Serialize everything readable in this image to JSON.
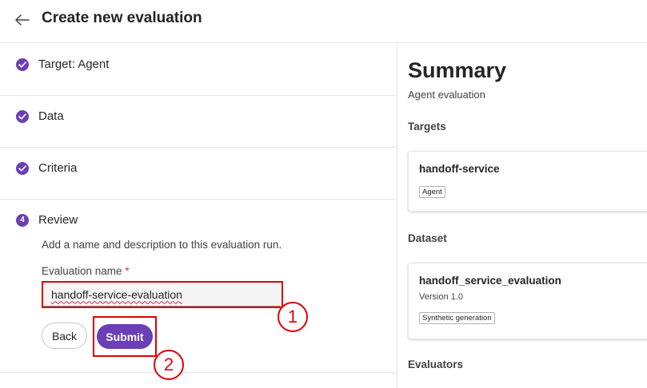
{
  "header": {
    "title": "Create new evaluation"
  },
  "steps": [
    {
      "label": "Target: Agent",
      "status": "complete"
    },
    {
      "label": "Data",
      "status": "complete"
    },
    {
      "label": "Criteria",
      "status": "complete"
    },
    {
      "label": "Review",
      "status": "current",
      "number": "4"
    }
  ],
  "review": {
    "description": "Add a name and description to this evaluation run.",
    "name_label": "Evaluation name",
    "required_mark": "*",
    "name_value": "handoff-service-evaluation",
    "back_label": "Back",
    "submit_label": "Submit"
  },
  "annotations": {
    "marker_1": "1",
    "marker_2": "2"
  },
  "summary": {
    "title": "Summary",
    "subtitle": "Agent evaluation",
    "targets_label": "Targets",
    "target": {
      "name": "handoff-service",
      "tag": "Agent"
    },
    "dataset_label": "Dataset",
    "dataset": {
      "name": "handoff_service_evaluation",
      "version": "Version 1.0",
      "tag": "Synthetic generation"
    },
    "evaluators_label": "Evaluators"
  },
  "colors": {
    "accent": "#6b3fb5",
    "annotation": "#e00000",
    "required": "#c4314b"
  }
}
